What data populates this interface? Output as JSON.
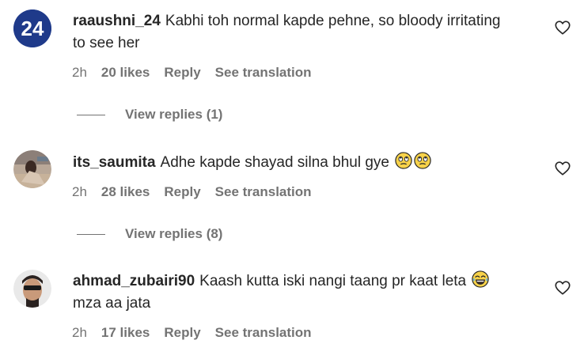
{
  "comments": [
    {
      "username": "raaushni_24",
      "text": "Kabhi toh normal kapde pehne, so bloody irritating to see her",
      "time": "2h",
      "likes": "20 likes",
      "reply": "Reply",
      "translate": "See translation",
      "view_replies": "View replies (1)",
      "avatar_icon": "avatar-24-logo",
      "avatar_text": "24"
    },
    {
      "username": "its_saumita",
      "text": "Adhe kapde shayad silna bhul gye",
      "emoji": [
        "eye-roll-emoji",
        "eye-roll-emoji"
      ],
      "time": "2h",
      "likes": "28 likes",
      "reply": "Reply",
      "translate": "See translation",
      "view_replies": "View replies (8)",
      "avatar_icon": "avatar-photo"
    },
    {
      "username": "ahmad_zubairi90",
      "text": "Kaash kutta iski nangi taang pr kaat leta",
      "text2": "mza aa jata",
      "emoji": [
        "laughing-tears-emoji"
      ],
      "time": "2h",
      "likes": "17 likes",
      "reply": "Reply",
      "translate": "See translation",
      "avatar_icon": "avatar-photo"
    }
  ],
  "colors": {
    "text": "#262626",
    "muted": "#737373",
    "avatar_24_bg": "#1f3a8a"
  }
}
